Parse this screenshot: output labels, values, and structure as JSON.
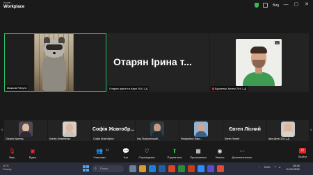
{
  "app": {
    "brand_top": "zoom",
    "brand_bottom": "Workplace",
    "view_label": "Вид"
  },
  "window_controls": {
    "minimize": "—",
    "maximize": "▢",
    "close": "✕"
  },
  "main_grid": [
    {
      "name": "Максим Рапути"
    },
    {
      "name": "Отарян Ірина та Карп 204-1-Д",
      "display_name": "Отарян Ірина т..."
    },
    {
      "name": "Бурхенко Артем 204-1-Д"
    }
  ],
  "strip": {
    "prev": "‹",
    "next": "›",
    "tiles": [
      {
        "name": "Оксана Кузнець"
      },
      {
        "name": "Ксенія Литвиненко"
      },
      {
        "name": "Софія Жовтобрюх",
        "display_name": "Софія Жовтобр..."
      },
      {
        "name": "Ігор Поручинський..."
      },
      {
        "name": "Ромашенко Макс..."
      },
      {
        "name": "Євген Лісний",
        "display_name": "Євген Лісний"
      },
      {
        "name": "Іван Деніс 204-1-Д"
      }
    ]
  },
  "toolbar": {
    "audio": "Звук",
    "video": "Відео",
    "participants": "Учасники",
    "participants_count": "22",
    "chat": "Чат",
    "reactions": "Отреагувати",
    "share": "Поділитися",
    "apps": "Приложения",
    "record": "Запись",
    "more": "Дополнительно",
    "leave": "Выйти"
  },
  "taskbar": {
    "weather_temp": "10°C",
    "weather_text": "Cloudy",
    "search_placeholder": "Поиск",
    "lang": "ENG",
    "time": "15:18",
    "date": "11.03.2025"
  }
}
